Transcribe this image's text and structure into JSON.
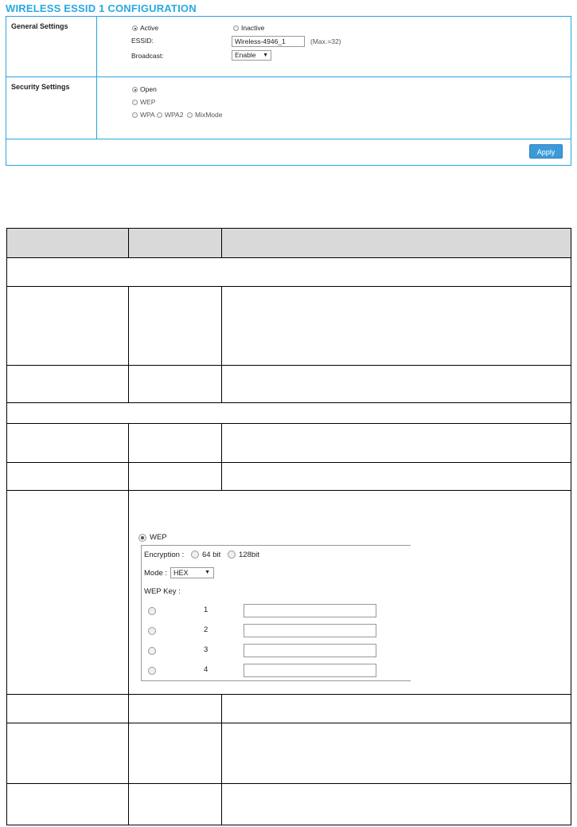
{
  "header": {
    "title": "WIRELESS ESSID 1 CONFIGURATION"
  },
  "general": {
    "label": "General Settings",
    "active_label": "Active",
    "inactive_label": "Inactive",
    "essid_label": "ESSID:",
    "essid_value": "Wireless-4946_1",
    "essid_hint": "(Max.=32)",
    "broadcast_label": "Broadcast:",
    "broadcast_value": "Enable"
  },
  "security": {
    "label": "Security Settings",
    "open_label": "Open",
    "wep_label": "WEP",
    "wpa_label": "WPA",
    "wpa2_label": "WPA2",
    "mixmode_label": "MixMode"
  },
  "actions": {
    "apply_label": "Apply"
  },
  "wep_figure": {
    "wep_label": "WEP",
    "encryption_label": "Encryption :",
    "bit64_label": "64 bit",
    "bit128_label": "128bit",
    "mode_label": "Mode :",
    "mode_value": "HEX",
    "key_label": "WEP Key :",
    "keys": [
      "1",
      "2",
      "3",
      "4"
    ]
  },
  "icons": {
    "dropdown": "chevron-down-icon"
  },
  "colors": {
    "accent": "#29a9e0",
    "button": "#3d9ad9",
    "border": "#2ba4dc"
  }
}
